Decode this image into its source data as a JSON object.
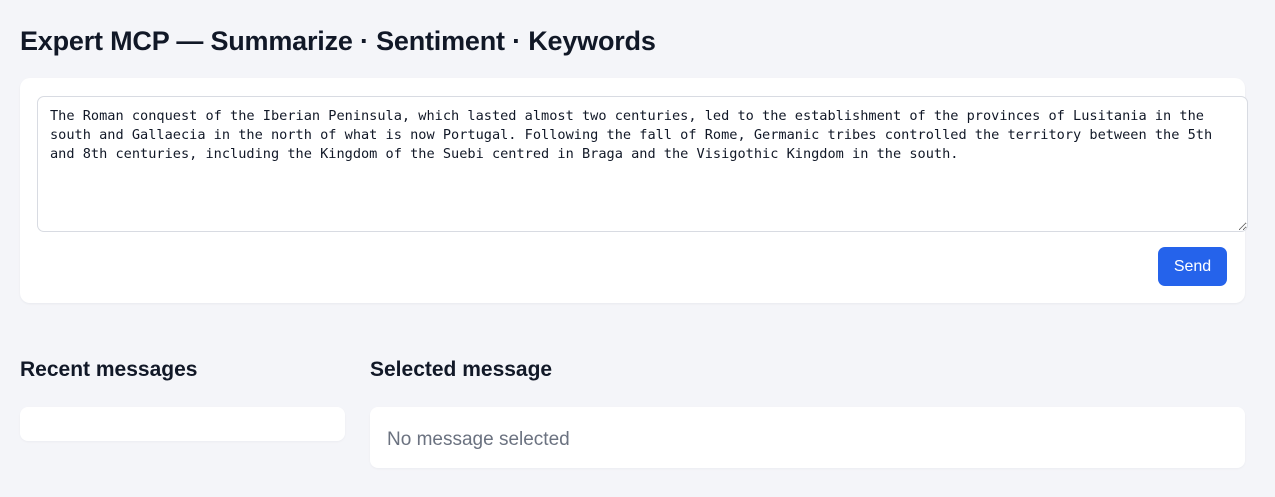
{
  "page": {
    "title": "Expert MCP — Summarize · Sentiment · Keywords"
  },
  "composer": {
    "message_value": "The Roman conquest of the Iberian Peninsula, which lasted almost two centuries, led to the establishment of the provinces of Lusitania in the south and Gallaecia in the north of what is now Portugal. Following the fall of Rome, Germanic tribes controlled the territory between the 5th and 8th centuries, including the Kingdom of the Suebi centred in Braga and the Visigothic Kingdom in the south.",
    "send_label": "Send"
  },
  "recent": {
    "heading": "Recent messages",
    "items": []
  },
  "selected": {
    "heading": "Selected message",
    "empty_text": "No message selected"
  },
  "colors": {
    "background": "#f4f5f9",
    "card": "#ffffff",
    "accent": "#2563eb",
    "muted_text": "#6b7280"
  }
}
